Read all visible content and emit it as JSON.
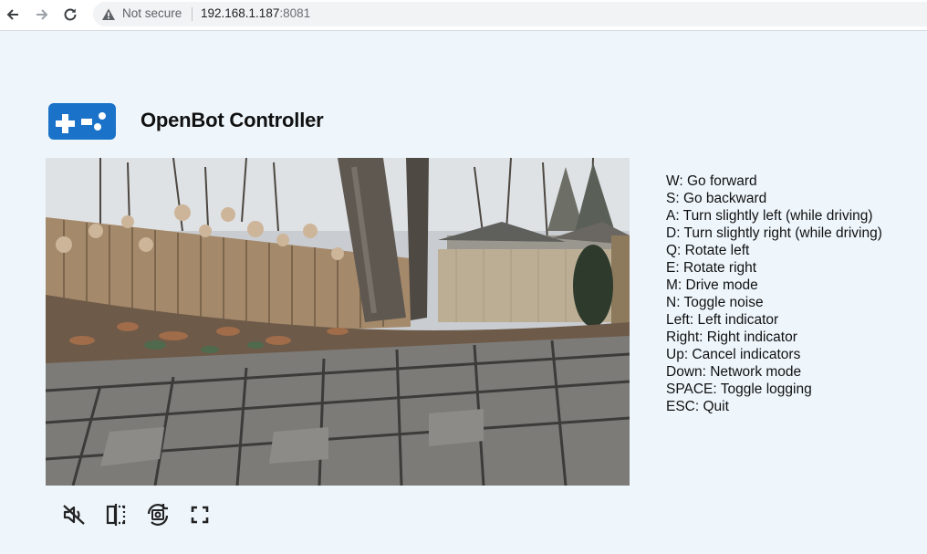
{
  "browser": {
    "security_label": "Not secure",
    "url_host": "192.168.1.187",
    "url_port": ":8081",
    "icons": [
      "back-arrow-icon",
      "forward-arrow-icon",
      "reload-icon",
      "warning-triangle-icon"
    ]
  },
  "app": {
    "title": "OpenBot Controller",
    "logo_icon": "gamepad-icon",
    "accent_color": "#1a73c8",
    "background_color": "#eef6fc"
  },
  "video": {
    "icon": "camera-feed"
  },
  "controls": [
    {
      "icon": "mute-icon"
    },
    {
      "icon": "mirror-icon"
    },
    {
      "icon": "switch-camera-icon"
    },
    {
      "icon": "fullscreen-icon"
    }
  ],
  "keymap": [
    "W: Go forward",
    "S: Go backward",
    "A: Turn slightly left (while driving)",
    "D: Turn slightly right (while driving)",
    "Q: Rotate left",
    "E: Rotate right",
    "M: Drive mode",
    "N: Toggle noise",
    "Left: Left indicator",
    "Right: Right indicator",
    "Up: Cancel indicators",
    "Down: Network mode",
    "SPACE: Toggle logging",
    "ESC: Quit"
  ]
}
